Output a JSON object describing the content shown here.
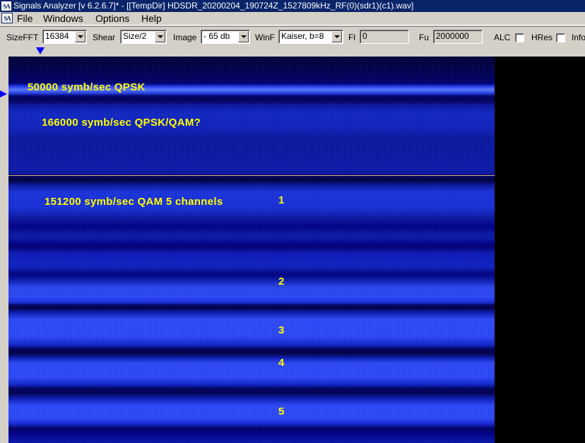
{
  "window": {
    "logo": "SA",
    "title": "Signals Analyzer [v 6.2.6.7]* - [[TempDir] HDSDR_20200204_190724Z_1527809kHz_RF(0)(sdr1)(c1).wav]"
  },
  "menu": {
    "items": [
      "File",
      "Windows",
      "Options",
      "Help"
    ]
  },
  "toolbar": {
    "sizefft_label": "SizeFFT",
    "sizefft_value": "16384",
    "shear_label": "Shear",
    "shear_value": "Size/2",
    "image_label": "Image",
    "image_value": "- 65 db",
    "winf_label": "WinF",
    "winf_value": "Kaiser, b=8",
    "fl_label": "Fl",
    "fl_value": "0",
    "fu_label": "Fu",
    "fu_value": "2000000",
    "alc_label": "ALC",
    "alc_checked": false,
    "hres_label": "HRes",
    "hres_checked": false,
    "info_label": "Info"
  },
  "spectrogram": {
    "colors": {
      "background": "#00004a",
      "signal": "#2d4aff",
      "annotation": "#ffff00",
      "separator": "#d0b060"
    },
    "annotations": [
      {
        "text": "50000 symb/sec QPSK"
      },
      {
        "text": "166000 symb/sec QPSK/QAM?"
      },
      {
        "text": "151200 symb/sec QAM  5 channels"
      }
    ],
    "channel_labels": [
      "1",
      "2",
      "3",
      "4",
      "5"
    ]
  }
}
